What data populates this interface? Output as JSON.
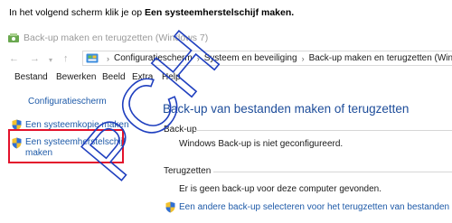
{
  "instruction": {
    "prefix": "In het volgend scherm klik je op ",
    "bold": "Een systeemherstelschijf maken."
  },
  "window": {
    "title": "Back-up maken en terugzetten (Windows 7)"
  },
  "address_bar": {
    "breadcrumbs": [
      "Configuratiescherm",
      "Systeem en beveiliging",
      "Back-up maken en terugzetten (Win"
    ]
  },
  "menu": [
    "Bestand",
    "Bewerken",
    "Beeld",
    "Extra",
    "Help"
  ],
  "left_panel": {
    "home_link": "Configuratiescherm",
    "system_image_link": "Een systeemkopie maken",
    "repair_disc_link_line1": "Een systeemherstelschijf",
    "repair_disc_link_line2": "maken"
  },
  "main": {
    "title": "Back-up van bestanden maken of terugzetten",
    "backup_section_header": "Back-up",
    "backup_status": "Windows Back-up is niet geconfigureerd.",
    "restore_section_header": "Terugzetten",
    "restore_status": "Er is geen back-up voor deze computer gevonden.",
    "restore_link": "Een andere back-up selecteren voor het terugzetten van bestanden"
  },
  "watermark": "PCH",
  "colors": {
    "highlight_border": "#e3122b",
    "link": "#1e5aa8",
    "title": "#1e4d9a",
    "watermark": "#1f3fbf"
  }
}
